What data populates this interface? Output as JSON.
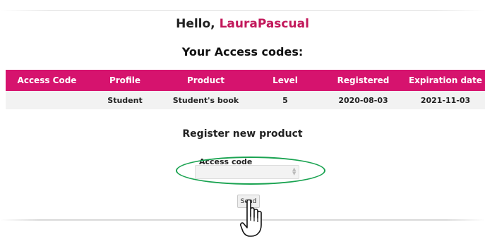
{
  "header": {
    "greeting_prefix": "Hello, ",
    "username": "LauraPascual"
  },
  "codes_section": {
    "title": "Your Access codes:",
    "columns": [
      "Access Code",
      "Profile",
      "Product",
      "Level",
      "Registered",
      "Expiration date"
    ],
    "rows": [
      {
        "access_code": "",
        "profile": "Student",
        "product": "Student's book",
        "level": "5",
        "registered": "2020-08-03",
        "expiration": "2021-11-03"
      }
    ]
  },
  "register_section": {
    "title": "Register new product",
    "access_code_label": "Access code",
    "access_code_value": "",
    "send_label": "Send"
  },
  "colors": {
    "accent": "#d6136e",
    "username": "#c2185b",
    "highlight": "#1aa351",
    "row_background": "#f2f2f2"
  },
  "icons": {
    "cursor": "hand-pointer-icon"
  }
}
